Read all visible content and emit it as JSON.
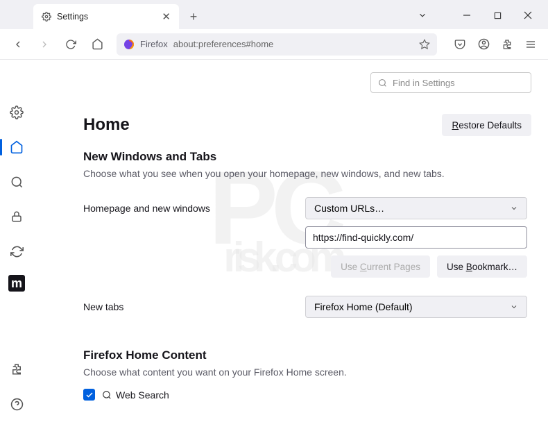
{
  "tab": {
    "title": "Settings"
  },
  "urlbar": {
    "identity": "Firefox",
    "address": "about:preferences#home"
  },
  "search": {
    "placeholder": "Find in Settings"
  },
  "page": {
    "title": "Home"
  },
  "buttons": {
    "restore": "Restore Defaults",
    "use_current": "Use Current Pages",
    "use_bookmark": "Use Bookmark…"
  },
  "sections": {
    "nwt": {
      "title": "New Windows and Tabs",
      "desc": "Choose what you see when you open your homepage, new windows, and new tabs."
    },
    "fhc": {
      "title": "Firefox Home Content",
      "desc": "Choose what content you want on your Firefox Home screen."
    }
  },
  "form": {
    "homepage_label": "Homepage and new windows",
    "homepage_select": "Custom URLs…",
    "homepage_value": "https://find-quickly.com/",
    "newtabs_label": "New tabs",
    "newtabs_select": "Firefox Home (Default)"
  },
  "checkbox": {
    "web_search": "Web Search"
  }
}
